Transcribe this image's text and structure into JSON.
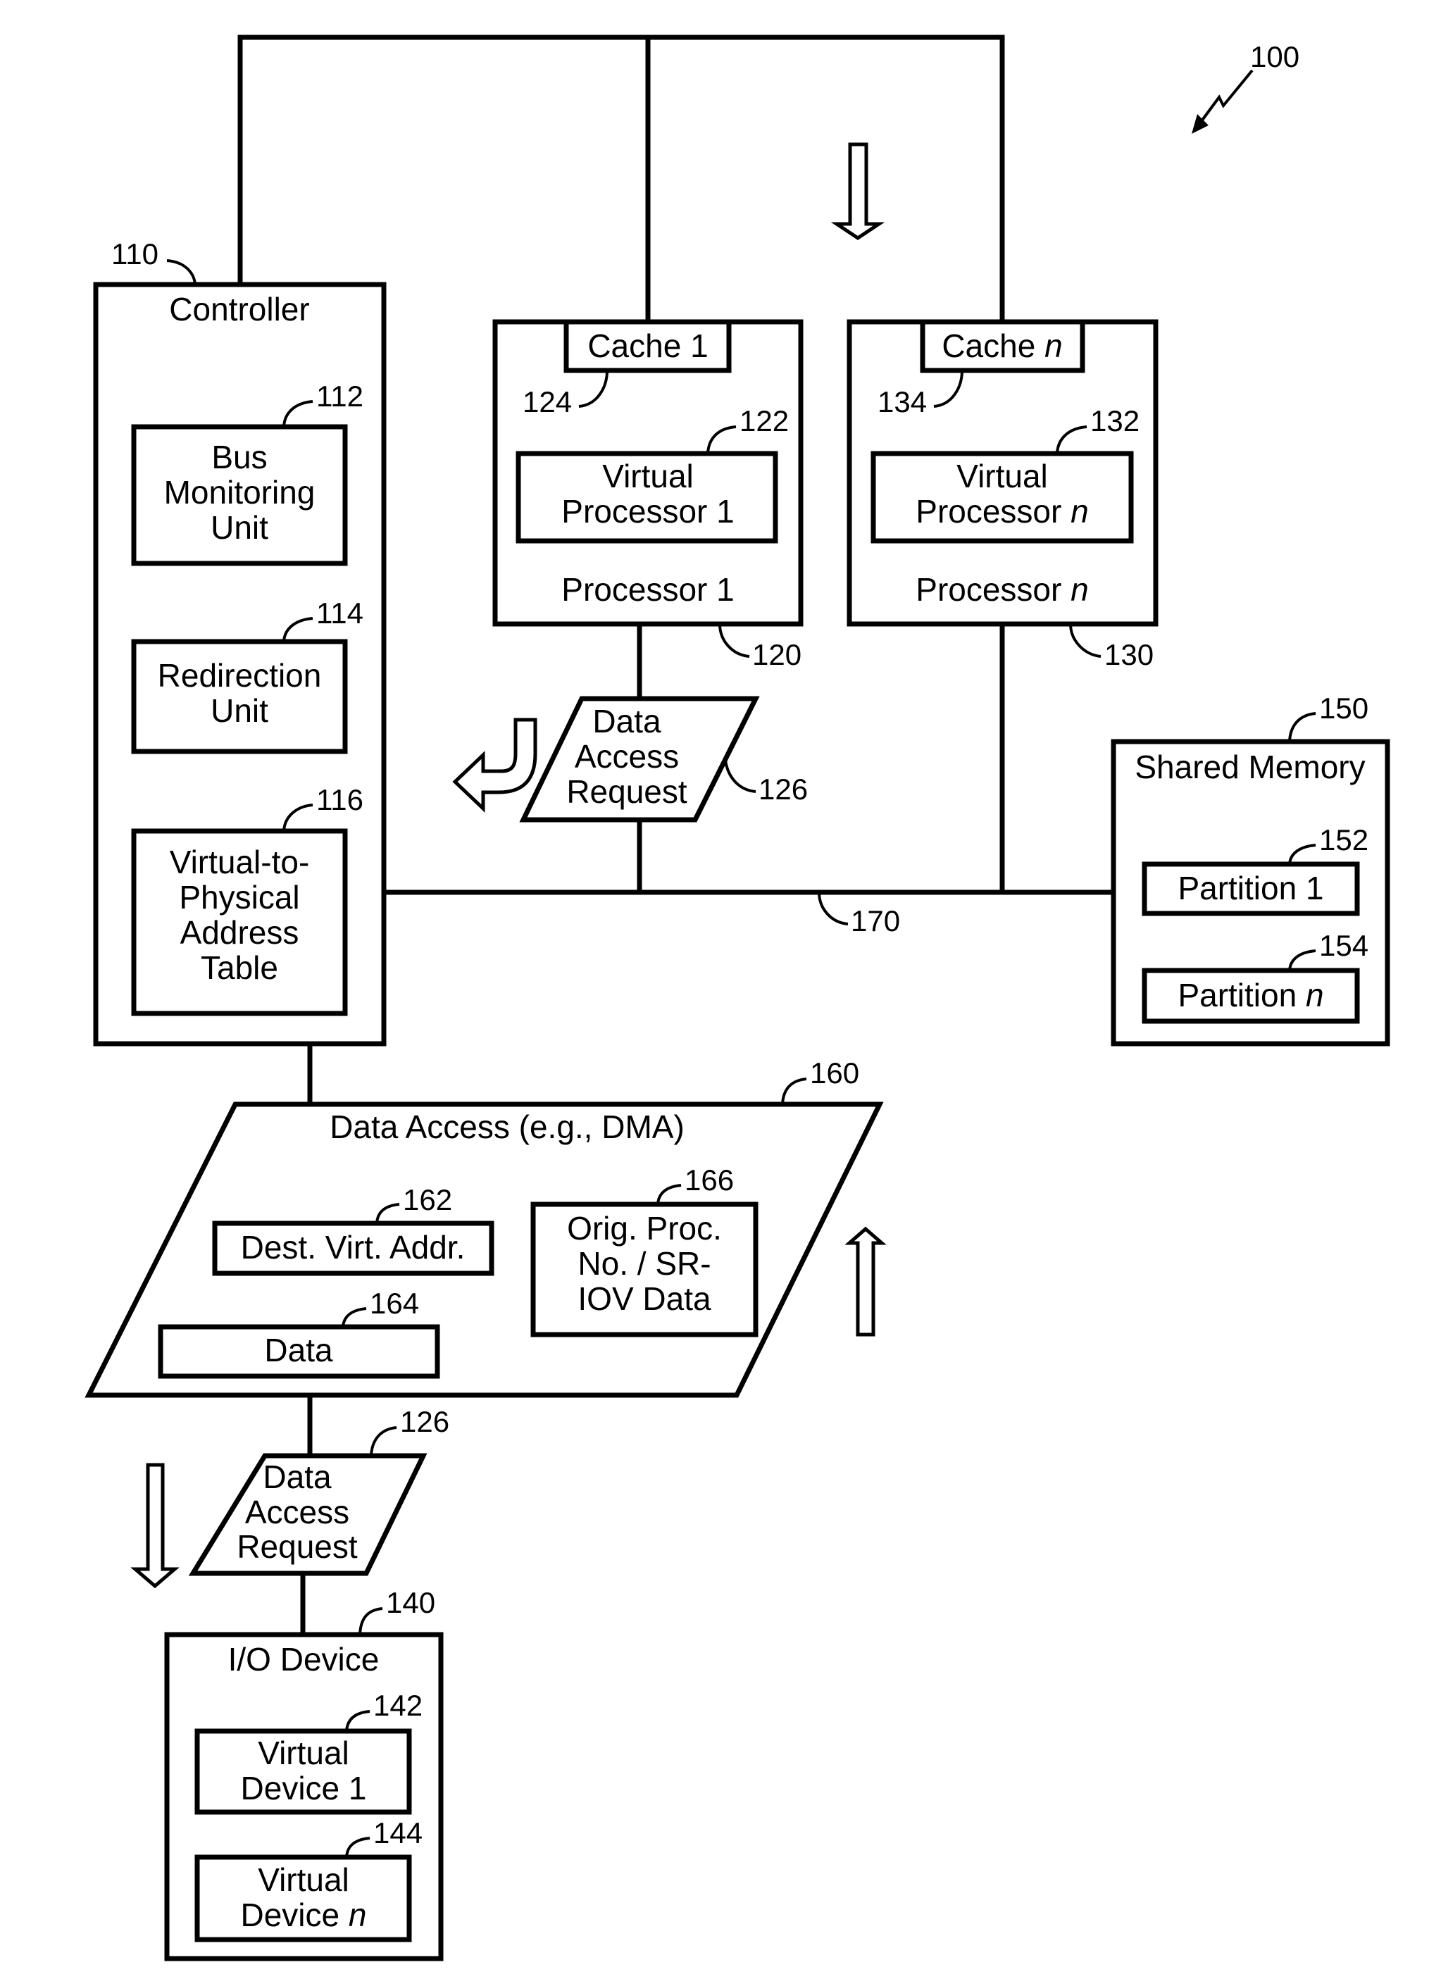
{
  "figure_ref": "100",
  "controller": {
    "ref": "110",
    "title": "Controller",
    "bus_monitoring": {
      "ref": "112",
      "lines": [
        "Bus",
        "Monitoring",
        "Unit"
      ]
    },
    "redirection": {
      "ref": "114",
      "lines": [
        "Redirection",
        "Unit"
      ]
    },
    "v2p_table": {
      "ref": "116",
      "lines": [
        "Virtual-to-",
        "Physical",
        "Address",
        "Table"
      ]
    }
  },
  "processor1": {
    "ref": "120",
    "title": "Processor 1",
    "cache": {
      "ref": "124",
      "label": "Cache 1"
    },
    "virtual": {
      "ref": "122",
      "lines": [
        "Virtual",
        "Processor 1"
      ]
    }
  },
  "processorn": {
    "ref": "130",
    "title": "Processor ",
    "title_n": "n",
    "cache": {
      "ref": "134",
      "label": "Cache ",
      "label_n": "n"
    },
    "virtual": {
      "ref": "132",
      "lines": [
        "Virtual",
        "Processor "
      ],
      "n": "n"
    }
  },
  "request_upper": {
    "ref": "126",
    "lines": [
      "Data",
      "Access",
      "Request"
    ]
  },
  "bus": {
    "ref": "170"
  },
  "shared_memory": {
    "ref": "150",
    "title": "Shared Memory",
    "partition1": {
      "ref": "152",
      "label": "Partition 1"
    },
    "partitionn": {
      "ref": "154",
      "label": "Partition ",
      "n": "n"
    }
  },
  "dma": {
    "ref": "160",
    "title": "Data Access (e.g., DMA)",
    "dest": {
      "ref": "162",
      "label": "Dest. Virt. Addr."
    },
    "data": {
      "ref": "164",
      "label": "Data"
    },
    "orig": {
      "ref": "166",
      "lines": [
        "Orig. Proc.",
        "No. / SR-",
        "IOV Data"
      ]
    }
  },
  "request_lower": {
    "ref": "126",
    "lines": [
      "Data",
      "Access",
      "Request"
    ]
  },
  "io_device": {
    "ref": "140",
    "title": "I/O Device",
    "vd1": {
      "ref": "142",
      "lines": [
        "Virtual",
        "Device 1"
      ]
    },
    "vdn": {
      "ref": "144",
      "lines": [
        "Virtual",
        "Device "
      ],
      "n": "n"
    }
  }
}
